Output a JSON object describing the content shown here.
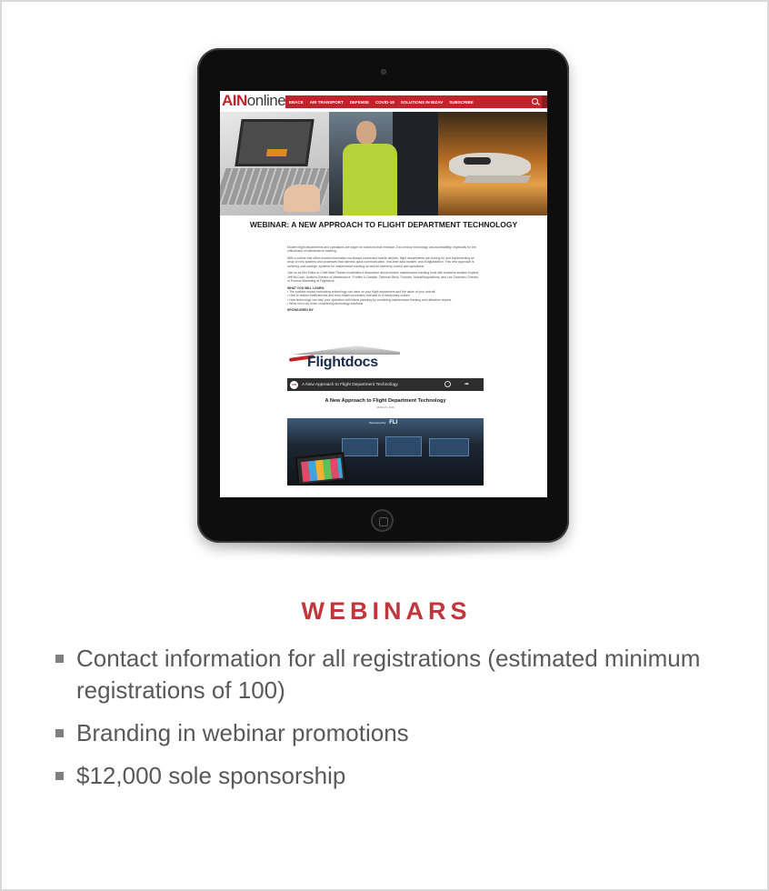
{
  "device": {
    "site": {
      "logo_ain": "AIN",
      "logo_online": "online",
      "nav": [
        "EBACE",
        "AIR TRANSPORT",
        "DEFENSE",
        "COVID-19",
        "SOLUTIONS IN BIZAV",
        "SUBSCRIBE"
      ],
      "article_title": "WEBINAR: A NEW APPROACH TO FLIGHT DEPARTMENT TECHNOLOGY",
      "paragraphs": [
        "Modern flight departments and operations are eager for solutions that embrace 21st century technology and accessibility, especially for the critical task of maintenance tracking.",
        "With a culture that offers instant information via always-connected mobile devices, flight departments are looking for and implementing an array of new systems and processes that harness quick communication, real-time data transfer, and eDigitalization. This new approach is ushering cost-savings, systems for maintenance tracking as well as inventory control and operations.",
        "Join us as AIN Editor-in-Chief Matt Thurber moderates a discussion about modern maintenance tracking tools with business aviation experts Jeff McCoan, Aviation Director of Maintenance, Frontier & Garside, Deborah Beck, Founder, AircraftAcquisitions, and Lee Snowden, Director of Product Marketing at Flightdocs."
      ],
      "learn_heading": "WHAT YOU WILL LEARN:",
      "learn_items": [
        "• The positive impact embracing technology can have on your flight department and the value of your aircraft.",
        "• How to reduce inefficiencies and error-ridden processes that add to a reactionary culture.",
        "• How technology can help your operation with future planning by combining maintenance tracking and utilization reports.",
        "• What not to do when considering technology solutions."
      ],
      "sponsored_by": "SPONSORED BY",
      "sponsor_logo": "Flightdocs",
      "video": {
        "channel_badge": "AIN",
        "bar_title": "A New Approach to Flight Department Technology",
        "slide_title": "A New Approach to Flight Department Technology",
        "slide_date": "APRIL 23, 2019",
        "overlay_text": "Sponsored by",
        "overlay_logo": "FLI"
      }
    }
  },
  "section": {
    "title": "WEBINARS",
    "bullets": [
      "Contact information for all registrations (estimated minimum registrations of 100)",
      "Branding in webinar promotions",
      "$12,000 sole sponsorship"
    ]
  },
  "colors": {
    "accent_red": "#c0363b",
    "body_text": "#595959",
    "bullet": "#7f7f7f"
  }
}
